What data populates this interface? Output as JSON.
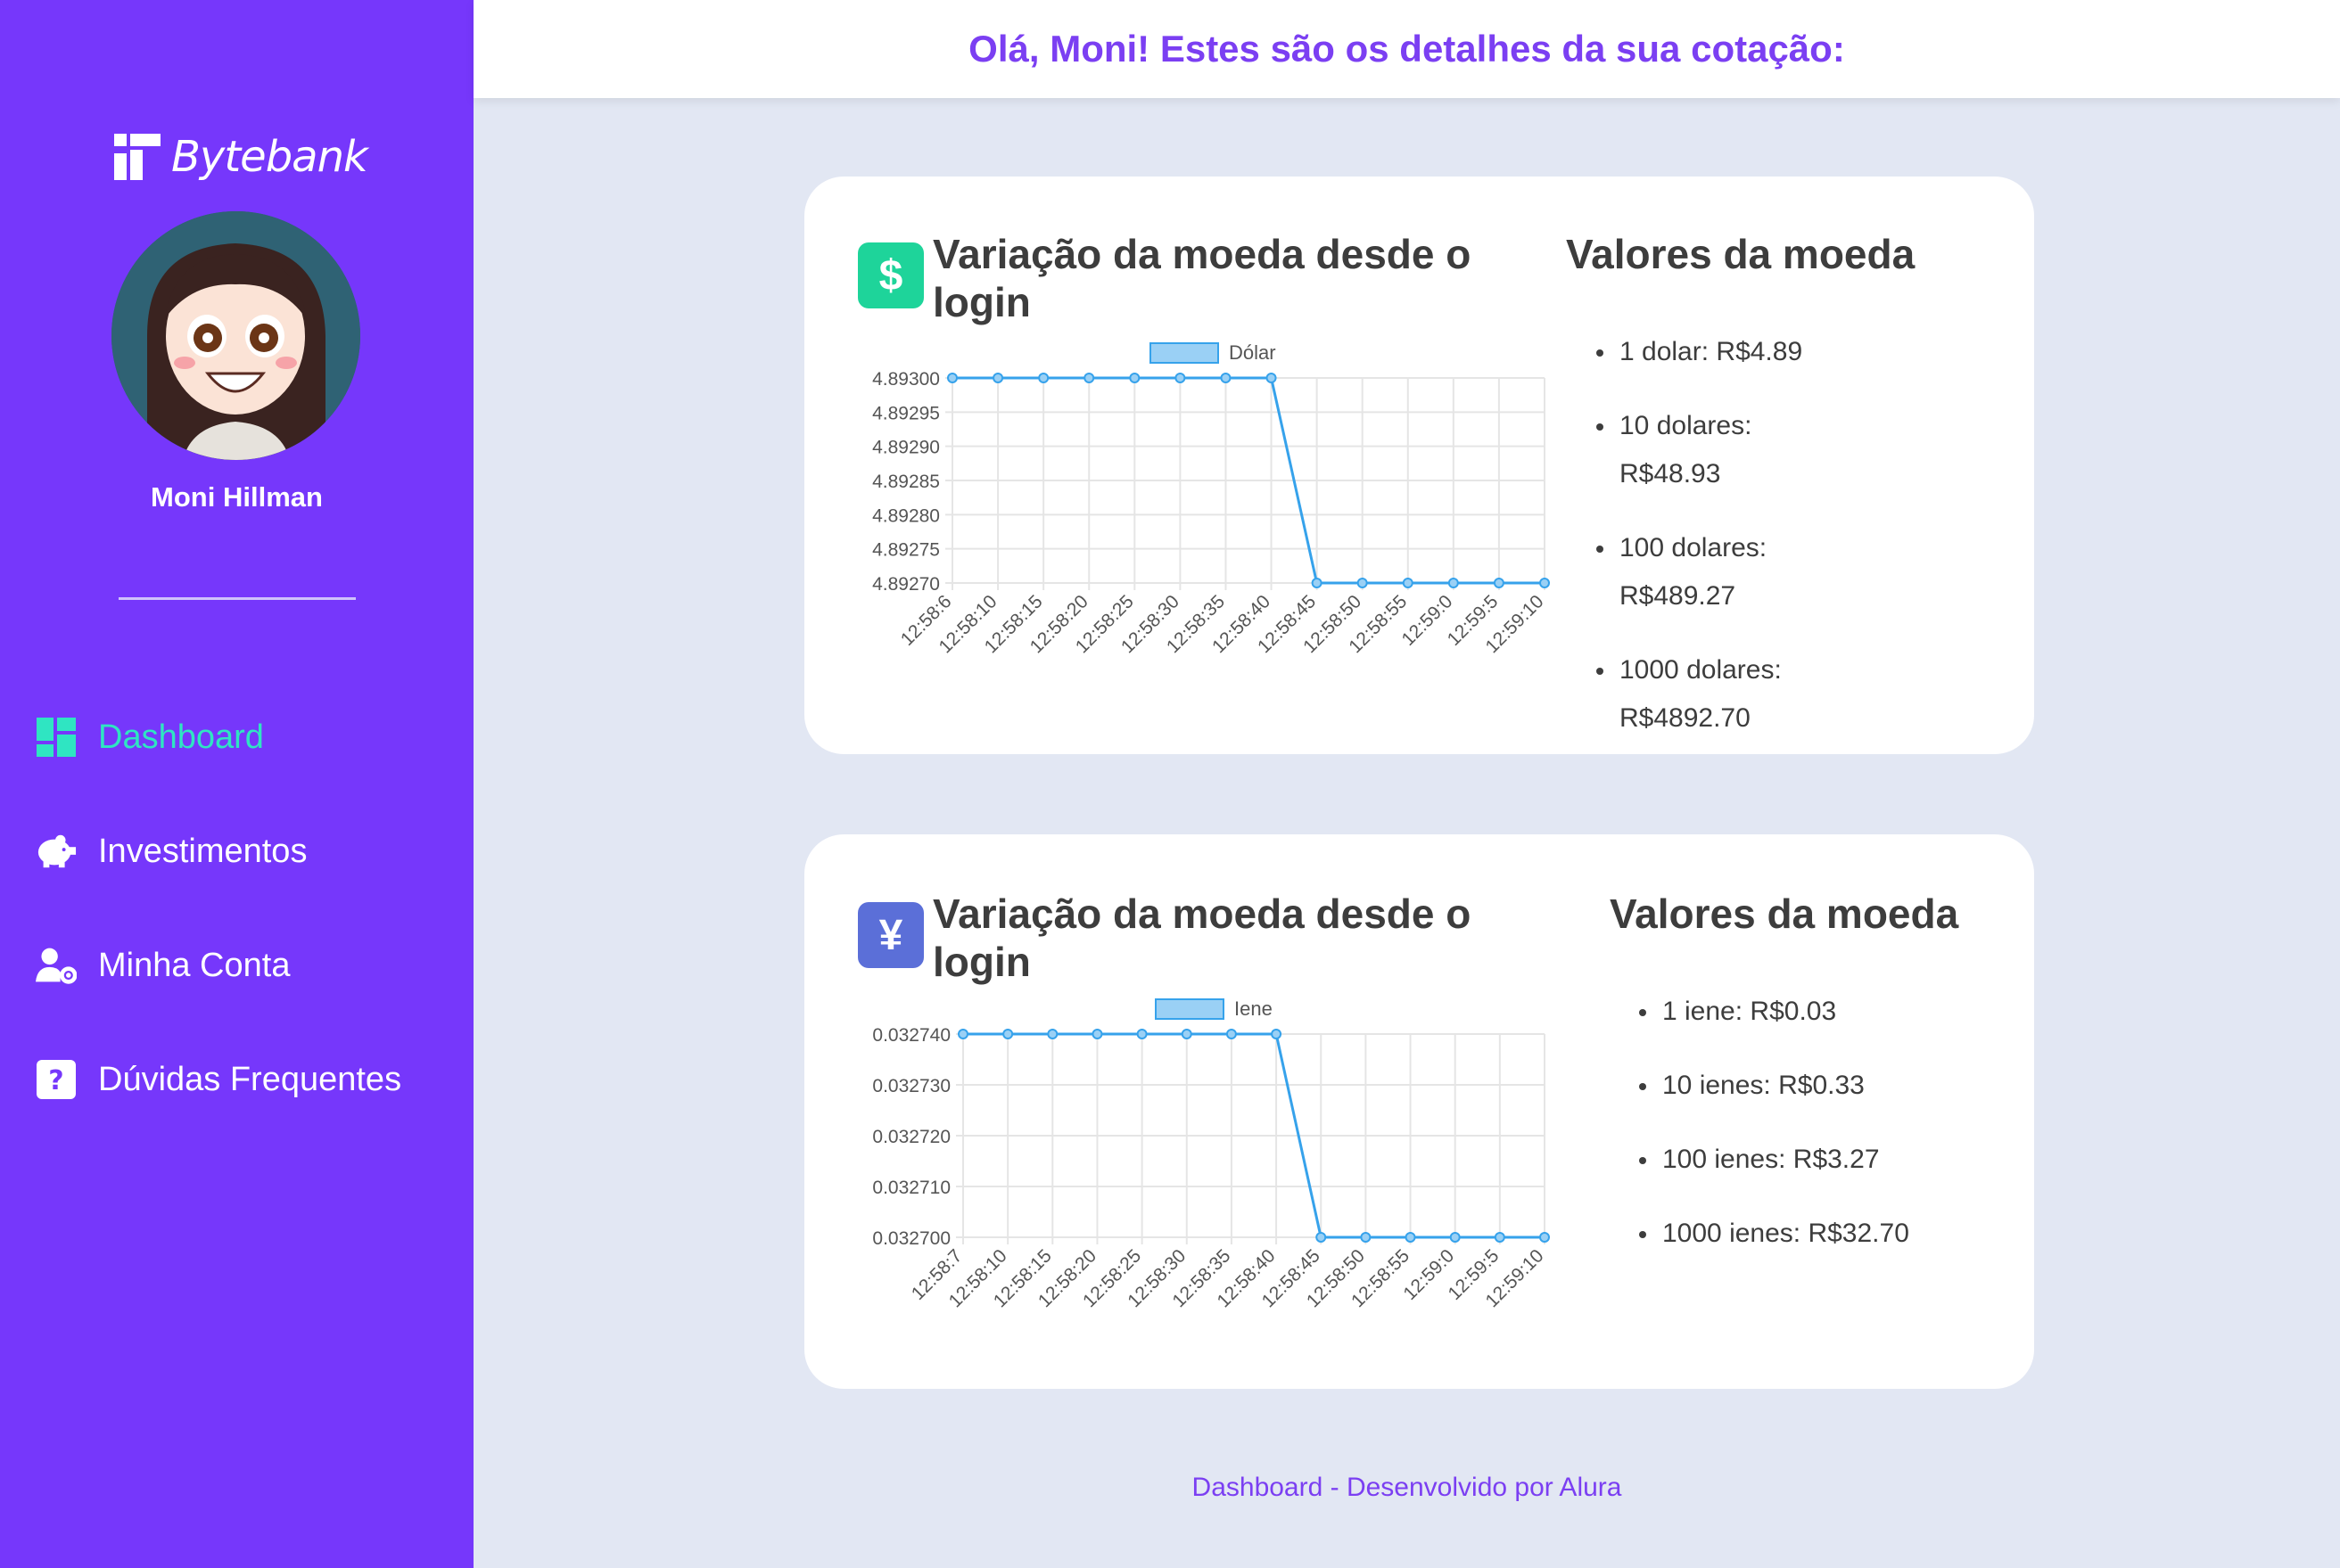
{
  "brand": {
    "name": "Bytebank"
  },
  "user": {
    "name": "Moni Hillman"
  },
  "nav": [
    {
      "label": "Dashboard",
      "icon": "dashboard-icon",
      "active": true
    },
    {
      "label": "Investimentos",
      "icon": "piggy-bank-icon",
      "active": false
    },
    {
      "label": "Minha Conta",
      "icon": "user-gear-icon",
      "active": false
    },
    {
      "label": "Dúvidas Frequentes",
      "icon": "question-icon",
      "active": false
    }
  ],
  "header": {
    "title": "Olá, Moni! Estes são os detalhes da sua cotação:"
  },
  "cards": [
    {
      "icon_symbol": "$",
      "icon_color": "#1ed49a",
      "chart_title": "Variação da moeda desde o login",
      "values_title": "Valores da moeda",
      "values": [
        "1 dolar: R$4.89",
        "10 dolares: R$48.93",
        "100 dolares: R$489.27",
        "1000 dolares: R$4892.70"
      ]
    },
    {
      "icon_symbol": "¥",
      "icon_color": "#5b6fd8",
      "chart_title": "Variação da moeda desde o login",
      "values_title": "Valores da moeda",
      "values": [
        "1 iene: R$0.03",
        "10 ienes: R$0.33",
        "100 ienes: R$3.27",
        "1000 ienes: R$32.70"
      ]
    }
  ],
  "chart_data": [
    {
      "type": "line",
      "x": [
        "12:58:6",
        "12:58:10",
        "12:58:15",
        "12:58:20",
        "12:58:25",
        "12:58:30",
        "12:58:35",
        "12:58:40",
        "12:58:45",
        "12:58:50",
        "12:58:55",
        "12:59:0",
        "12:59:5",
        "12:59:10"
      ],
      "series": [
        {
          "name": "Dólar",
          "values": [
            4.893,
            4.893,
            4.893,
            4.893,
            4.893,
            4.893,
            4.893,
            4.893,
            4.8927,
            4.8927,
            4.8927,
            4.8927,
            4.8927,
            4.8927
          ]
        }
      ],
      "yticks": [
        "4.89300",
        "4.89295",
        "4.89290",
        "4.89285",
        "4.89280",
        "4.89275",
        "4.89270"
      ],
      "ylim": [
        4.8927,
        4.893
      ],
      "grid": true,
      "legend": "top",
      "color": "#36a2eb"
    },
    {
      "type": "line",
      "x": [
        "12:58:7",
        "12:58:10",
        "12:58:15",
        "12:58:20",
        "12:58:25",
        "12:58:30",
        "12:58:35",
        "12:58:40",
        "12:58:45",
        "12:58:50",
        "12:58:55",
        "12:59:0",
        "12:59:5",
        "12:59:10"
      ],
      "series": [
        {
          "name": "Iene",
          "values": [
            0.03274,
            0.03274,
            0.03274,
            0.03274,
            0.03274,
            0.03274,
            0.03274,
            0.03274,
            0.0327,
            0.0327,
            0.0327,
            0.0327,
            0.0327,
            0.0327
          ]
        }
      ],
      "yticks": [
        "0.032740",
        "0.032730",
        "0.032720",
        "0.032710",
        "0.032700"
      ],
      "ylim": [
        0.0327,
        0.03274
      ],
      "grid": true,
      "legend": "top",
      "color": "#36a2eb"
    }
  ],
  "footer": {
    "text": "Dashboard - Desenvolvido por Alura"
  }
}
